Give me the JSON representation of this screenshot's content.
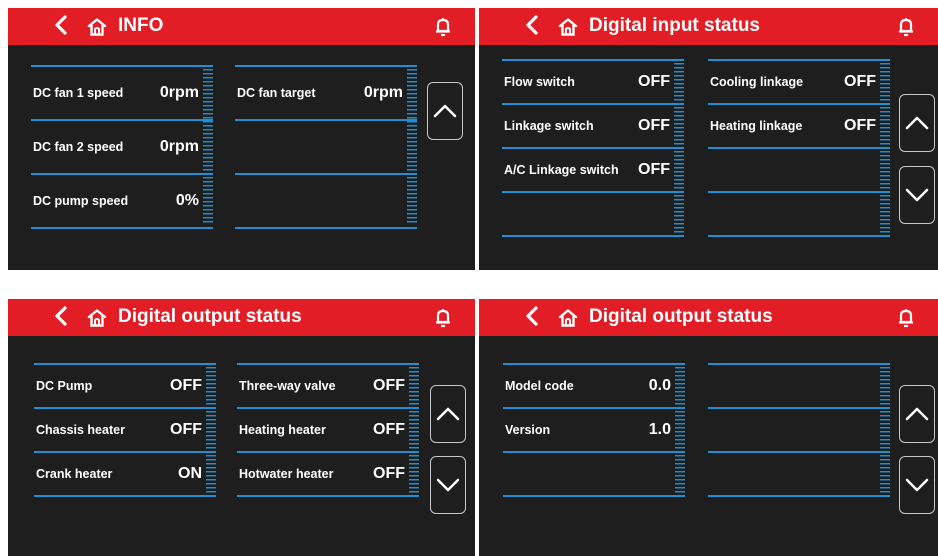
{
  "colors": {
    "header": "#e31d25",
    "background": "#1e1e1e",
    "line": "#1f8fd6",
    "text": "#ffffff"
  },
  "icons": {
    "back": "chevron-left-icon",
    "home": "home-icon",
    "bell": "bell-icon",
    "up": "chevron-up-icon",
    "down": "chevron-down-icon"
  },
  "panels": [
    {
      "title": "INFO",
      "left": [
        {
          "label": "DC fan 1 speed",
          "value": "0rpm"
        },
        {
          "label": "DC fan 2 speed",
          "value": "0rpm"
        },
        {
          "label": "DC pump speed",
          "value": "0%"
        }
      ],
      "right": [
        {
          "label": "DC fan target",
          "value": "0rpm"
        },
        {
          "label": "",
          "value": ""
        },
        {
          "label": "",
          "value": ""
        }
      ]
    },
    {
      "title": "Digital input status",
      "left": [
        {
          "label": "Flow switch",
          "value": "OFF"
        },
        {
          "label": "Linkage switch",
          "value": "OFF"
        },
        {
          "label": "A/C Linkage switch",
          "value": "OFF"
        },
        {
          "label": "",
          "value": ""
        }
      ],
      "right": [
        {
          "label": "Cooling linkage",
          "value": "OFF"
        },
        {
          "label": "Heating linkage",
          "value": "OFF"
        },
        {
          "label": "",
          "value": ""
        },
        {
          "label": "",
          "value": ""
        }
      ]
    },
    {
      "title": "Digital output status",
      "left": [
        {
          "label": "DC Pump",
          "value": "OFF"
        },
        {
          "label": "Chassis heater",
          "value": "OFF"
        },
        {
          "label": "Crank heater",
          "value": "ON"
        }
      ],
      "right": [
        {
          "label": "Three-way valve",
          "value": "OFF"
        },
        {
          "label": "Heating  heater",
          "value": "OFF"
        },
        {
          "label": "Hotwater  heater",
          "value": "OFF"
        }
      ]
    },
    {
      "title": "Digital output status",
      "left": [
        {
          "label": "Model code",
          "value": "0.0"
        },
        {
          "label": "Version",
          "value": "1.0"
        },
        {
          "label": "",
          "value": ""
        }
      ],
      "right": [
        {
          "label": "",
          "value": ""
        },
        {
          "label": "",
          "value": ""
        },
        {
          "label": "",
          "value": ""
        }
      ]
    }
  ]
}
